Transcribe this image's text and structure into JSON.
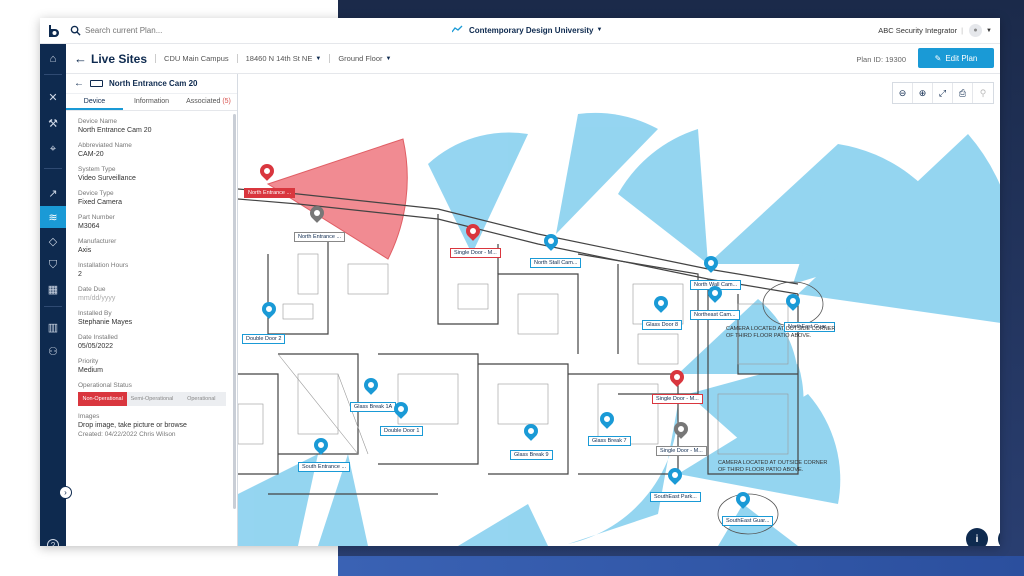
{
  "topbar": {
    "search_placeholder": "Search current Plan...",
    "org_name": "Contemporary Design University",
    "user_name": "ABC Security Integrator"
  },
  "header": {
    "title": "Live Sites",
    "campus": "CDU Main Campus",
    "address": "18460 N 14th St NE",
    "floor": "Ground Floor",
    "plan_id": "Plan ID: 19300",
    "edit_label": "Edit Plan"
  },
  "panel": {
    "device_title": "North Entrance Cam 20",
    "tabs": {
      "device": "Device",
      "information": "Information",
      "associated": "Associated",
      "associated_count": "(5)"
    },
    "fields": [
      {
        "label": "Device Name",
        "value": "North Entrance Cam 20"
      },
      {
        "label": "Abbreviated Name",
        "value": "CAM-20"
      },
      {
        "label": "System Type",
        "value": "Video Surveillance"
      },
      {
        "label": "Device Type",
        "value": "Fixed Camera"
      },
      {
        "label": "Part Number",
        "value": "M3064"
      },
      {
        "label": "Manufacturer",
        "value": "Axis"
      },
      {
        "label": "Installation Hours",
        "value": "2"
      },
      {
        "label": "Date Due",
        "value": "mm/dd/yyyy"
      },
      {
        "label": "Installed By",
        "value": "Stephanie Mayes"
      },
      {
        "label": "Date Installed",
        "value": "05/05/2022"
      },
      {
        "label": "Priority",
        "value": "Medium"
      }
    ],
    "status_label": "Operational Status",
    "status_options": [
      "Non-Operational",
      "Semi-Operational",
      "Operational"
    ],
    "images_label": "Images",
    "images_hint": "Drop image, take picture or browse",
    "images_created": "Created: 04/22/2022 Chris Wilson"
  },
  "map": {
    "devices": [
      {
        "label": "North Entrance ...",
        "status": "red"
      },
      {
        "label": "North Entrance ...",
        "status": "gray"
      },
      {
        "label": "Single Door - M...",
        "status": "red"
      },
      {
        "label": "North Stall Cam...",
        "status": "blue"
      },
      {
        "label": "North Wall Cam...",
        "status": "blue"
      },
      {
        "label": "Glass Door 8",
        "status": "blue"
      },
      {
        "label": "Northeast Cam...",
        "status": "blue"
      },
      {
        "label": "NorthEast Guar...",
        "status": "blue"
      },
      {
        "label": "Double Door 2",
        "status": "blue"
      },
      {
        "label": "Glass Break 1A",
        "status": "blue"
      },
      {
        "label": "Double Door 1",
        "status": "blue"
      },
      {
        "label": "Single Door - M...",
        "status": "red"
      },
      {
        "label": "Glass Break 7",
        "status": "blue"
      },
      {
        "label": "Glass Break 9",
        "status": "blue"
      },
      {
        "label": "Single Door - M...",
        "status": "gray"
      },
      {
        "label": "South Entrance ...",
        "status": "blue"
      },
      {
        "label": "SouthEast Park...",
        "status": "blue"
      },
      {
        "label": "SouthEast Guar...",
        "status": "blue"
      }
    ],
    "notes": [
      "CAMERA LOCATED AT OUTSIDE CORNER OF THIRD FLOOR PATIO ABOVE.",
      "CAMERA LOCATED AT OUTSIDE CORNER OF THIRD FLOOR PATIO ABOVE."
    ]
  },
  "colors": {
    "navy": "#0e2a4f",
    "accent": "#1a9ad6",
    "alert": "#d9363e",
    "coverage": "#8fd3f0"
  }
}
